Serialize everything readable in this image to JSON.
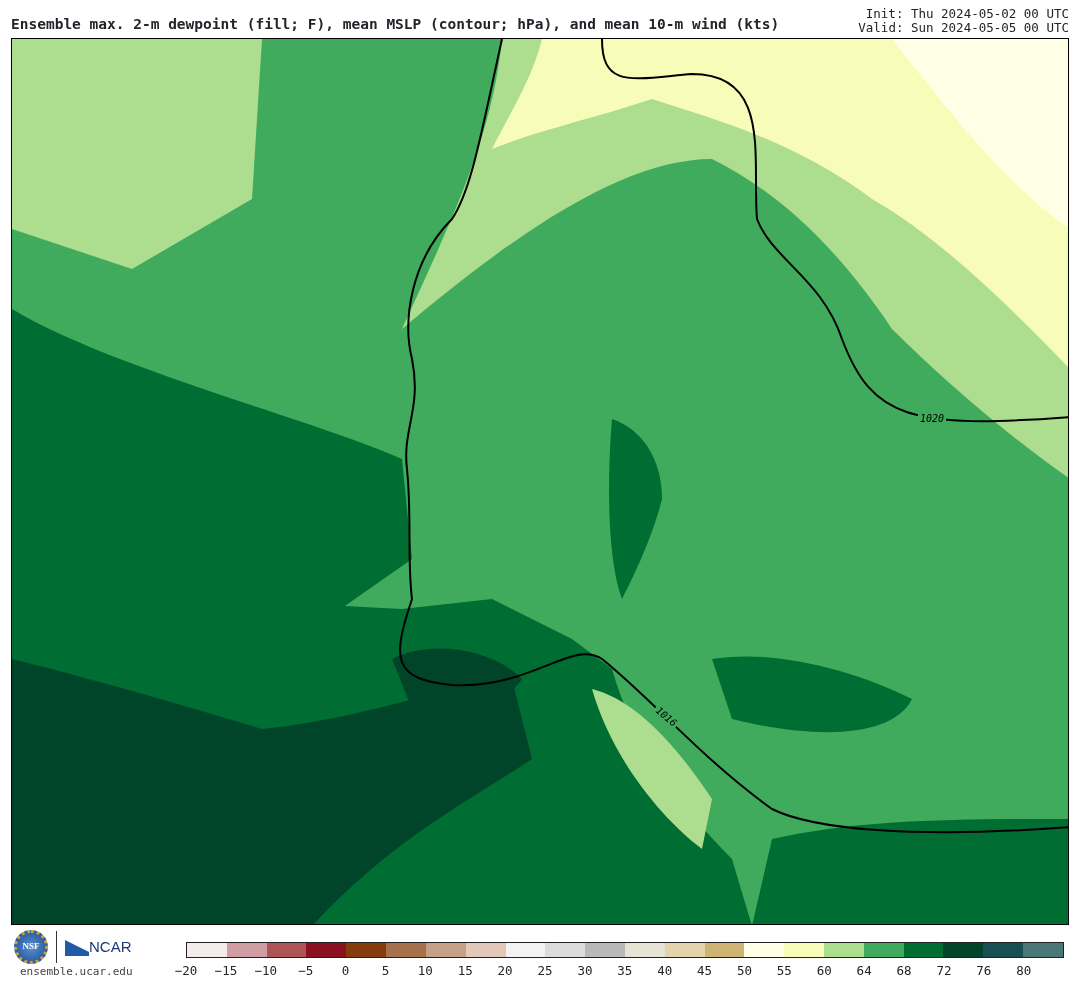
{
  "header": {
    "title": "Ensemble max. 2-m dewpoint (fill; F), mean MSLP (contour; hPa), and mean 10-m wind (kts)",
    "init": "Init: Thu 2024-05-02 00 UTC",
    "valid": "Valid: Sun 2024-05-05 00 UTC"
  },
  "map": {
    "contour_labels": [
      "1020",
      "1016"
    ]
  },
  "footer": {
    "nsf_logo_text": "NSF",
    "ncar_logo_text": "NCAR",
    "site": "ensemble.ucar.edu"
  },
  "colorbar": {
    "bins": [
      {
        "color": "#f4ecec"
      },
      {
        "color": "#cf9da2"
      },
      {
        "color": "#ae5457"
      },
      {
        "color": "#8b1020"
      },
      {
        "color": "#843c0d"
      },
      {
        "color": "#a7704d"
      },
      {
        "color": "#c5a088"
      },
      {
        "color": "#e1c8b8"
      },
      {
        "color": "#f3f3f3"
      },
      {
        "color": "#dcdcdc"
      },
      {
        "color": "#b8b8b8"
      },
      {
        "color": "#e6e4d4"
      },
      {
        "color": "#e4d4ac"
      },
      {
        "color": "#cdb473"
      },
      {
        "color": "#ffffe5"
      },
      {
        "color": "#f7fcb9"
      },
      {
        "color": "#addd8e"
      },
      {
        "color": "#41ab5d"
      },
      {
        "color": "#006d32"
      },
      {
        "color": "#00442a"
      },
      {
        "color": "#174f55"
      },
      {
        "color": "#4a7878"
      }
    ],
    "ticks": [
      "−20",
      "−15",
      "−10",
      "−5",
      "0",
      "5",
      "10",
      "15",
      "20",
      "25",
      "30",
      "35",
      "40",
      "45",
      "50",
      "55",
      "60",
      "64",
      "68",
      "72",
      "76",
      "80"
    ]
  }
}
